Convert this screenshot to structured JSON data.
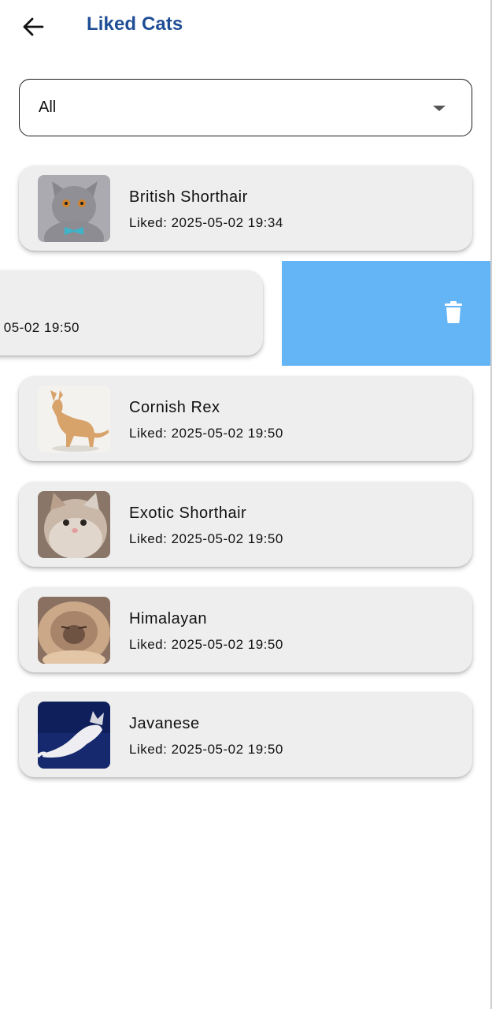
{
  "app_bar": {
    "title": "Liked Cats",
    "back_icon": "arrow-left-icon",
    "title_color": "#1f4e96"
  },
  "filter": {
    "selected": "All",
    "icon": "caret-down-icon"
  },
  "swipe_action": {
    "partial_date_text": "05-02 19:50",
    "background_color": "#64b5f6",
    "icon": "trash-icon"
  },
  "liked_cats": [
    {
      "name": "British Shorthair",
      "liked": "Liked: 2025-05-02 19:34"
    },
    {
      "name": "Cornish Rex",
      "liked": "Liked: 2025-05-02 19:50"
    },
    {
      "name": "Exotic Shorthair",
      "liked": "Liked: 2025-05-02 19:50"
    },
    {
      "name": "Himalayan",
      "liked": "Liked: 2025-05-02 19:50"
    },
    {
      "name": "Javanese",
      "liked": "Liked: 2025-05-02 19:50"
    }
  ]
}
